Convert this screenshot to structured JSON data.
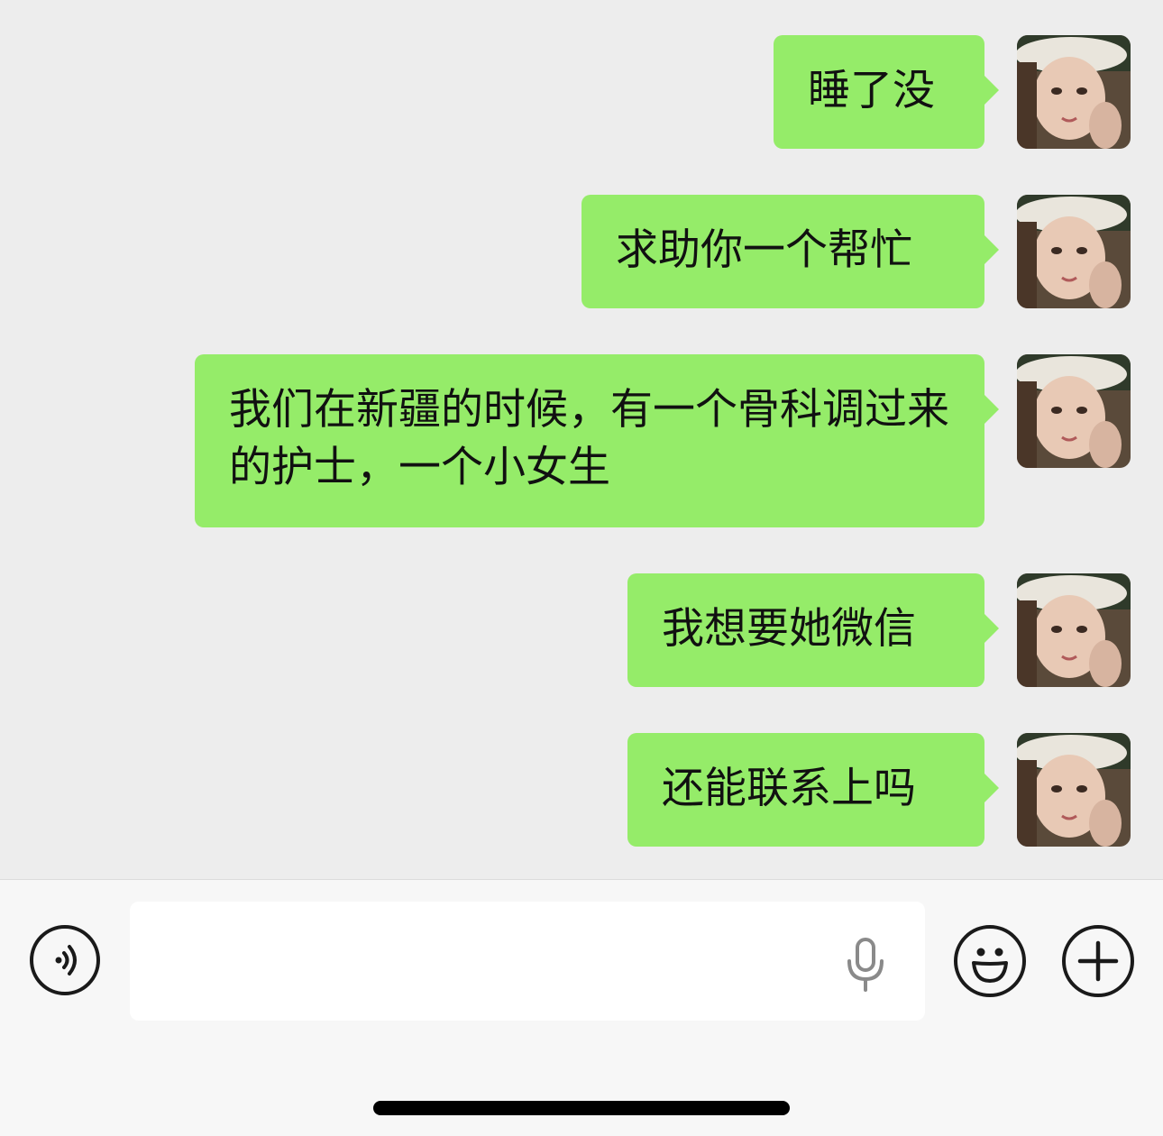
{
  "messages": [
    {
      "text": "睡了没",
      "sender": "me"
    },
    {
      "text": "求助你一个帮忙",
      "sender": "me"
    },
    {
      "text": "我们在新疆的时候，有一个骨科调过来的护士，一个小女生",
      "sender": "me"
    },
    {
      "text": "我想要她微信",
      "sender": "me"
    },
    {
      "text": "还能联系上吗",
      "sender": "me"
    }
  ],
  "colors": {
    "bubble": "#95ec69",
    "background": "#ededed",
    "input_bar": "#f7f7f7"
  },
  "input_bar": {
    "voice_icon": "voice-wave-icon",
    "text_value": "",
    "mic_icon": "microphone-icon",
    "emoji_icon": "smiley-icon",
    "plus_icon": "plus-icon"
  }
}
